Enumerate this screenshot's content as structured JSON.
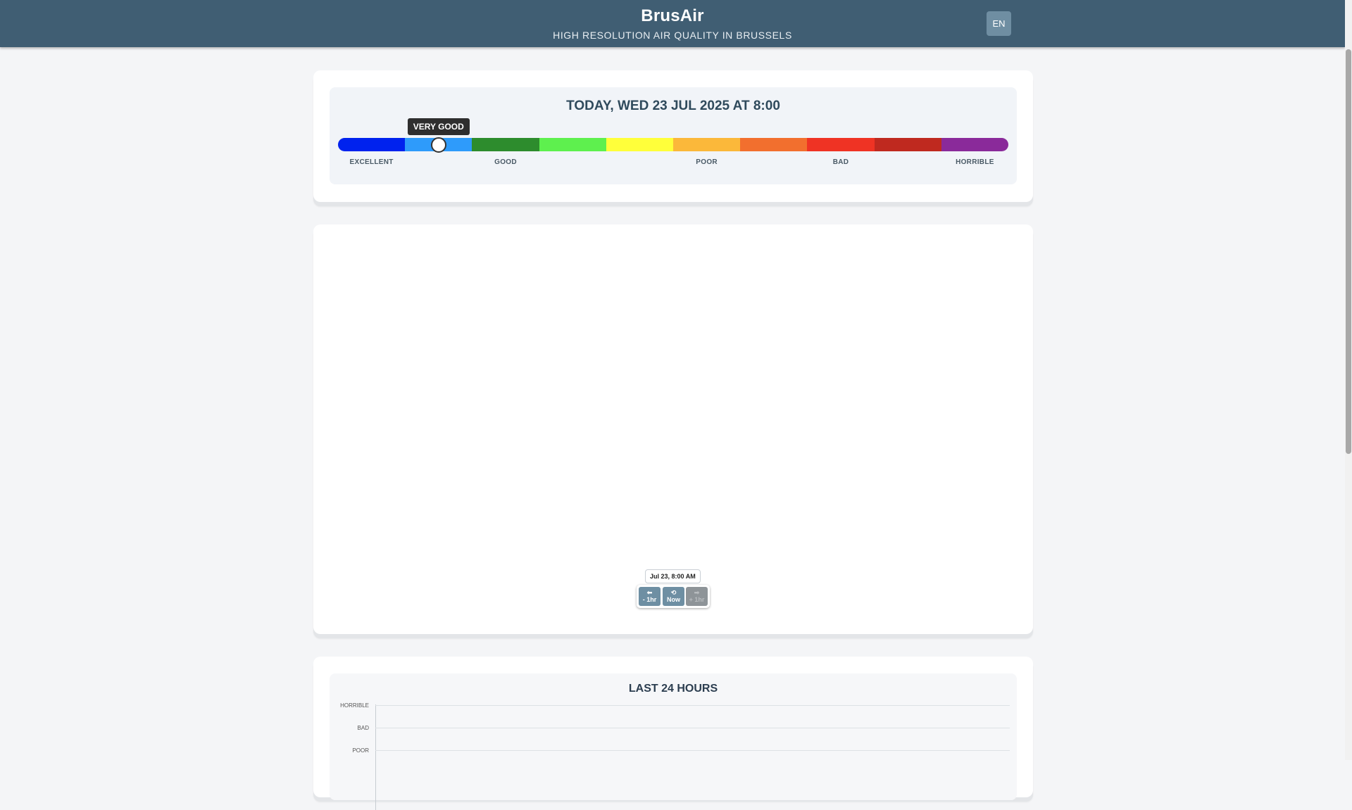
{
  "header": {
    "title": "BrusAir",
    "subtitle": "HIGH RESOLUTION AIR QUALITY IN BRUSSELS",
    "language": "EN"
  },
  "current_status": {
    "date_label": "TODAY, WED 23 JUL 2025 AT 8:00",
    "level_label": "VERY GOOD",
    "level_fraction": 0.15,
    "scale_colors": [
      "#0022ee",
      "#2e9bfb",
      "#2d8c2d",
      "#5ef04e",
      "#ffff3a",
      "#fbb83a",
      "#f26f2e",
      "#ef3324",
      "#bf291f",
      "#8a2a9a"
    ],
    "scale_labels": [
      {
        "text": "EXCELLENT",
        "segment": 0
      },
      {
        "text": "GOOD",
        "segment": 2
      },
      {
        "text": "POOR",
        "segment": 5
      },
      {
        "text": "BAD",
        "segment": 7
      },
      {
        "text": "HORRIBLE",
        "segment": 9
      }
    ]
  },
  "map_controls": {
    "timestamp": "Jul 23, 8:00 AM",
    "back_icon": "arrow-left-icon",
    "back_label": "- 1hr",
    "now_icon": "reset-icon",
    "now_label": "Now",
    "forward_icon": "arrow-right-icon",
    "forward_label": "+ 1hr"
  },
  "history": {
    "title": "LAST 24 HOURS",
    "y_levels": [
      "HORRIBLE",
      "BAD",
      "POOR"
    ]
  }
}
